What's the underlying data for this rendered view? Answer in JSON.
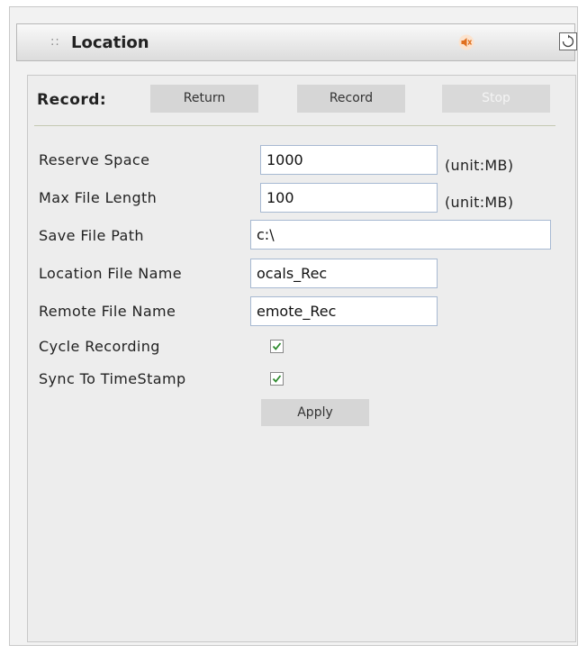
{
  "panel": {
    "title": "Location",
    "grip": "::"
  },
  "record": {
    "label": "Record:",
    "return_label": "Return",
    "record_label": "Record",
    "stop_label": "Stop"
  },
  "fields": {
    "reserve_space": {
      "label": "Reserve Space",
      "value": "1000",
      "unit": "(unit:MB)"
    },
    "max_file_length": {
      "label": "Max File Length",
      "value": "100",
      "unit": "(unit:MB)"
    },
    "save_file_path": {
      "label": "Save File Path",
      "value": "c:\\"
    },
    "location_file_name": {
      "label": "Location File Name",
      "value": "ocals_Rec"
    },
    "remote_file_name": {
      "label": "Remote File Name",
      "value": "emote_Rec"
    },
    "cycle_recording": {
      "label": "Cycle Recording",
      "checked": true
    },
    "sync_to_timestamp": {
      "label": "Sync To TimeStamp",
      "checked": true
    }
  },
  "apply_label": "Apply",
  "colors": {
    "check": "#2e8b2e",
    "speaker": "#e0701f"
  }
}
